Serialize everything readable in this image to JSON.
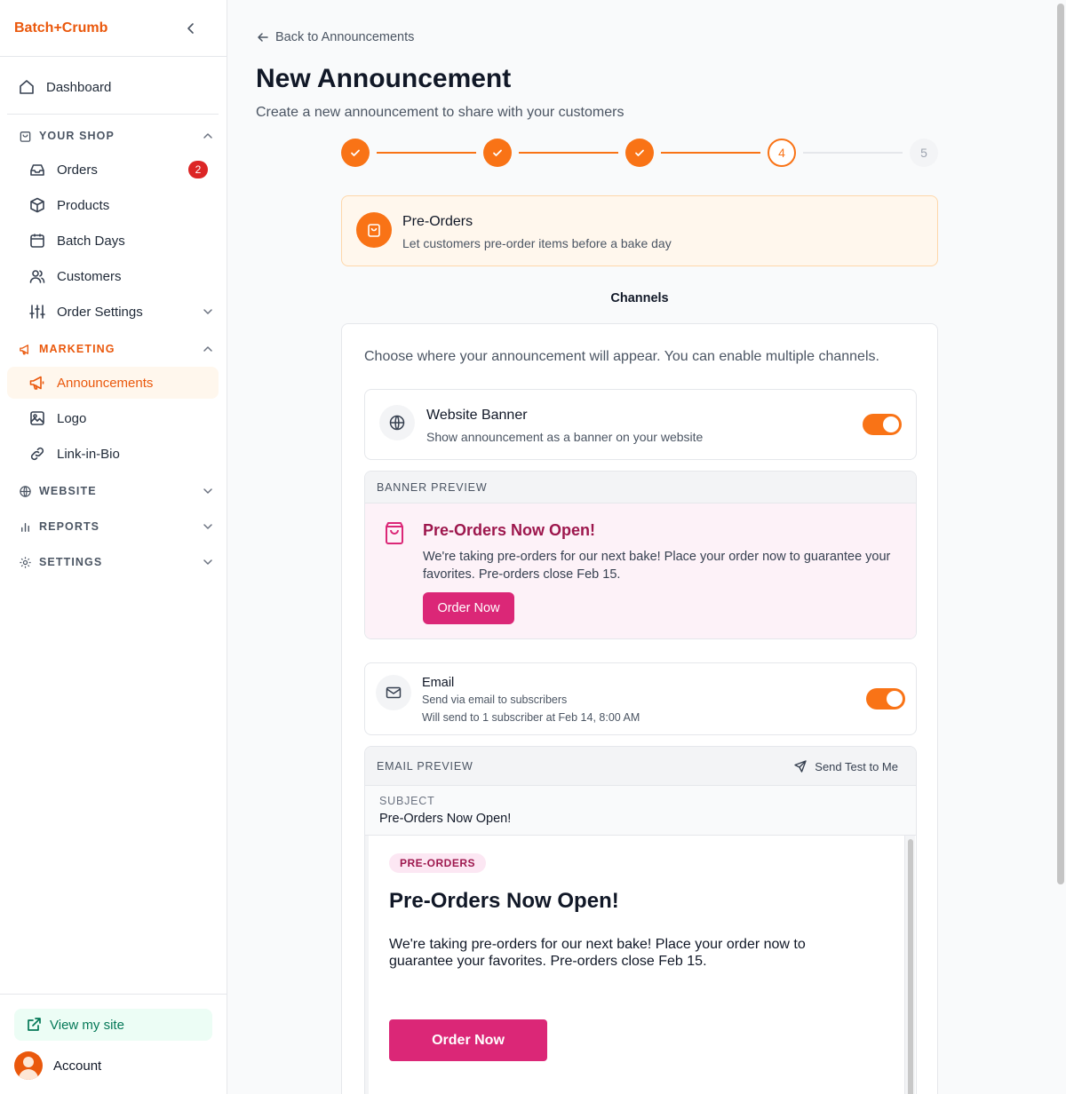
{
  "app": {
    "brand": "Batch+Crumb"
  },
  "sidebar": {
    "dashboard": "Dashboard",
    "your_shop": "YOUR SHOP",
    "orders": "Orders",
    "orders_badge": "2",
    "products": "Products",
    "batch_days": "Batch Days",
    "customers": "Customers",
    "order_settings": "Order Settings",
    "marketing": "MARKETING",
    "announcements": "Announcements",
    "logo": "Logo",
    "link_in_bio": "Link-in-Bio",
    "website": "WEBSITE",
    "reports": "REPORTS",
    "settings": "SETTINGS",
    "view_site": "View my site",
    "account": "Account"
  },
  "page": {
    "back_link": "Back to Announcements",
    "title": "New Announcement",
    "subtitle": "Create a new announcement to share with your customers",
    "steps": [
      {
        "state": "done",
        "label": ""
      },
      {
        "state": "done",
        "label": ""
      },
      {
        "state": "done",
        "label": ""
      },
      {
        "state": "current",
        "label": "4"
      },
      {
        "state": "future",
        "label": "5"
      }
    ],
    "type_card": {
      "title": "Pre-Orders",
      "description": "Let customers pre-order items before a bake day"
    },
    "step_label": "Channels",
    "channels_intro": "Choose where your announcement will appear. You can enable multiple channels."
  },
  "channels": {
    "website_banner": {
      "title": "Website Banner",
      "description": "Show announcement as a banner on your website",
      "enabled": true
    },
    "banner_preview": {
      "heading": "BANNER PREVIEW",
      "title": "Pre-Orders Now Open!",
      "text": "We're taking pre-orders for our next bake! Place your order now to guarantee your favorites. Pre-orders close Feb 15.",
      "button": "Order Now"
    },
    "email": {
      "title": "Email",
      "description": "Send via email to subscribers",
      "schedule": "Will send to 1 subscriber at Feb 14, 8:00 AM",
      "enabled": true
    },
    "email_preview": {
      "heading": "EMAIL PREVIEW",
      "send_test": "Send Test to Me",
      "subject_label": "SUBJECT",
      "subject": "Pre-Orders Now Open!",
      "tag": "PRE-ORDERS",
      "title": "Pre-Orders Now Open!",
      "text": "We're taking pre-orders for our next bake! Place your order now to guarantee your favorites. Pre-orders close Feb 15.",
      "button": "Order Now"
    }
  },
  "colors": {
    "brand_orange": "#f97316",
    "accent_pink": "#db2777",
    "badge_red": "#dc2626"
  }
}
